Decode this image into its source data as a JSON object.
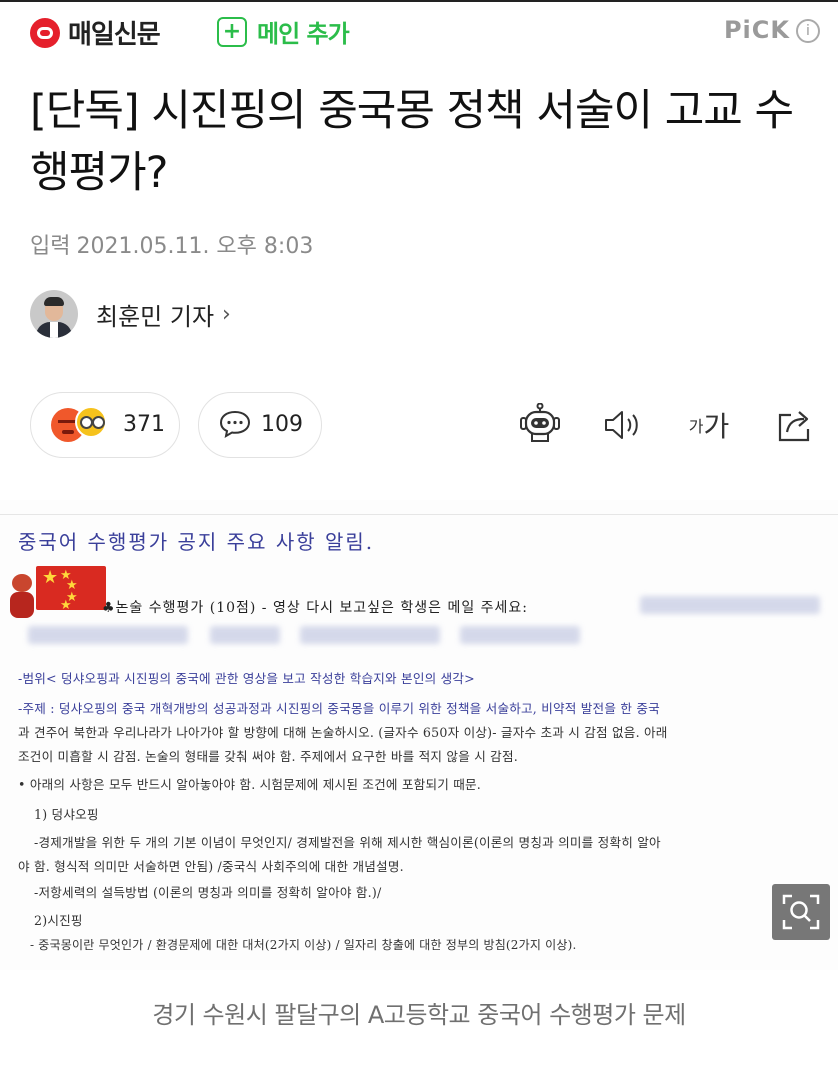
{
  "header": {
    "brand": "매일신문",
    "add_main_plus": "+",
    "add_main_label": "메인 추가",
    "pick_label": "PiCK",
    "info_glyph": "i"
  },
  "article": {
    "title": "[단독] 시진핑의 중국몽 정책 서술이 고교 수행평가?",
    "date_label": "입력",
    "date": "2021.05.11. 오후 8:03",
    "author": "최훈민 기자",
    "author_chevron": "›"
  },
  "actions": {
    "reaction_count": "371",
    "comment_count": "109",
    "font_small": "가",
    "font_big": "가"
  },
  "document": {
    "heading": "중국어 수행평가 공지 주요 사항 알림.",
    "lead": "♣논술 수행평가 (10점)   - 영상 다시 보고싶은 학생은 메일 주세요:",
    "lines": [
      "-범위< 덩샤오핑과 시진핑의 중국에 관한 영상을 보고 작성한 학습지와 본인의 생각>",
      "-주제 : 덩샤오핑의 중국 개혁개방의 성공과정과 시진핑의 중국몽을 이루기 위한 정책을 서술하고, 비약적 발전을 한 중국",
      "과 견주어 북한과 우리나라가 나아가야 할 방향에 대해 논술하시오. (글자수 650자 이상)- 글자수 초과 시 감점 없음. 아래",
      "조건이 미흡할 시 감점. 논술의 형태를 갖춰 써야 함. 주제에서 요구한 바를 적지 않을 시 감점.",
      "• 아래의 사항은 모두 반드시 알아놓아야 함. 시험문제에 제시된 조건에 포함되기 때문.",
      "1) 덩샤오핑",
      "-경제개발을 위한 두 개의 기본 이념이 무엇인지/ 경제발전을 위해 제시한 핵심이론(이론의 명칭과 의미를 정확히 알아",
      "야 함. 형식적 의미만 서술하면 안됨) /중국식 사회주의에 대한 개념설명.",
      "-저항세력의 설득방법 (이론의 명칭과 의미를 정확히 알아야 함.)/",
      "2)시진핑",
      "- 중국몽이란 무엇인가 / 환경문제에 대한 대처(2가지 이상) / 일자리 창출에 대한 정부의 방침(2가지 이상)."
    ]
  },
  "caption": "경기 수원시 팔달구의 A고등학교 중국어 수행평가 문제",
  "colors": {
    "brand_red": "#e5202c",
    "add_green": "#2bbd4a",
    "doc_blue": "#3a3f9a"
  },
  "icons": [
    "angry-reaction-icon",
    "wow-reaction-icon",
    "comment-bubble-icon",
    "robot-read-icon",
    "speaker-icon",
    "share-icon",
    "magnify-icon"
  ]
}
